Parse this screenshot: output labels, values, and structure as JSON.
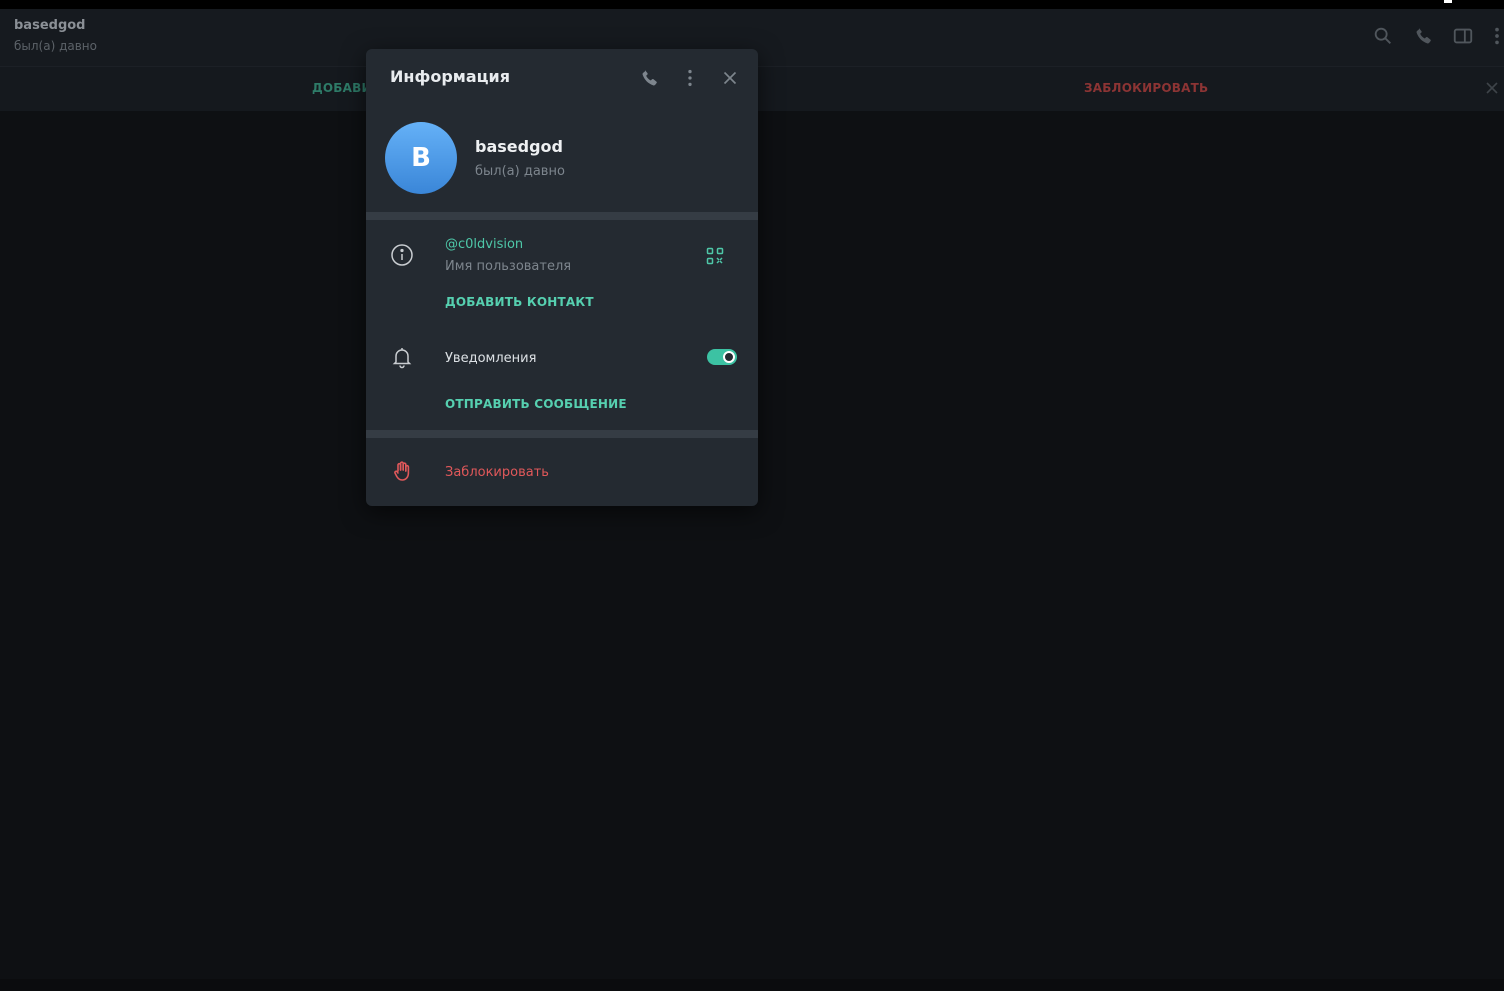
{
  "chat": {
    "title": "basedgod",
    "status": "был(а) давно"
  },
  "action_bar": {
    "add_label": "ДОБАВИТЬ КОНТАКТ",
    "block_label": "ЗАБЛОКИРОВАТЬ"
  },
  "dialog": {
    "title": "Информация",
    "avatar_letter": "B",
    "name": "basedgod",
    "status": "был(а) давно",
    "username": "@c0ldvision",
    "username_label": "Имя пользователя",
    "add_contact": "ДОБАВИТЬ КОНТАКТ",
    "notifications_label": "Уведомления",
    "notifications_enabled": true,
    "send_message": "ОТПРАВИТЬ СООБЩЕНИЕ",
    "block": "Заблокировать"
  },
  "icons": {
    "search": "search-icon",
    "call": "phone-icon",
    "sidebar": "sidebar-toggle-icon",
    "menu": "more-vertical-icon",
    "close": "close-icon",
    "info": "info-icon",
    "qr": "qr-code-icon",
    "bell": "bell-icon",
    "hand": "hand-block-icon"
  },
  "colors": {
    "accent": "#4ec7a8",
    "danger": "#e0585a",
    "avatar": "#4a98e8",
    "dialog_bg": "#242a31"
  }
}
